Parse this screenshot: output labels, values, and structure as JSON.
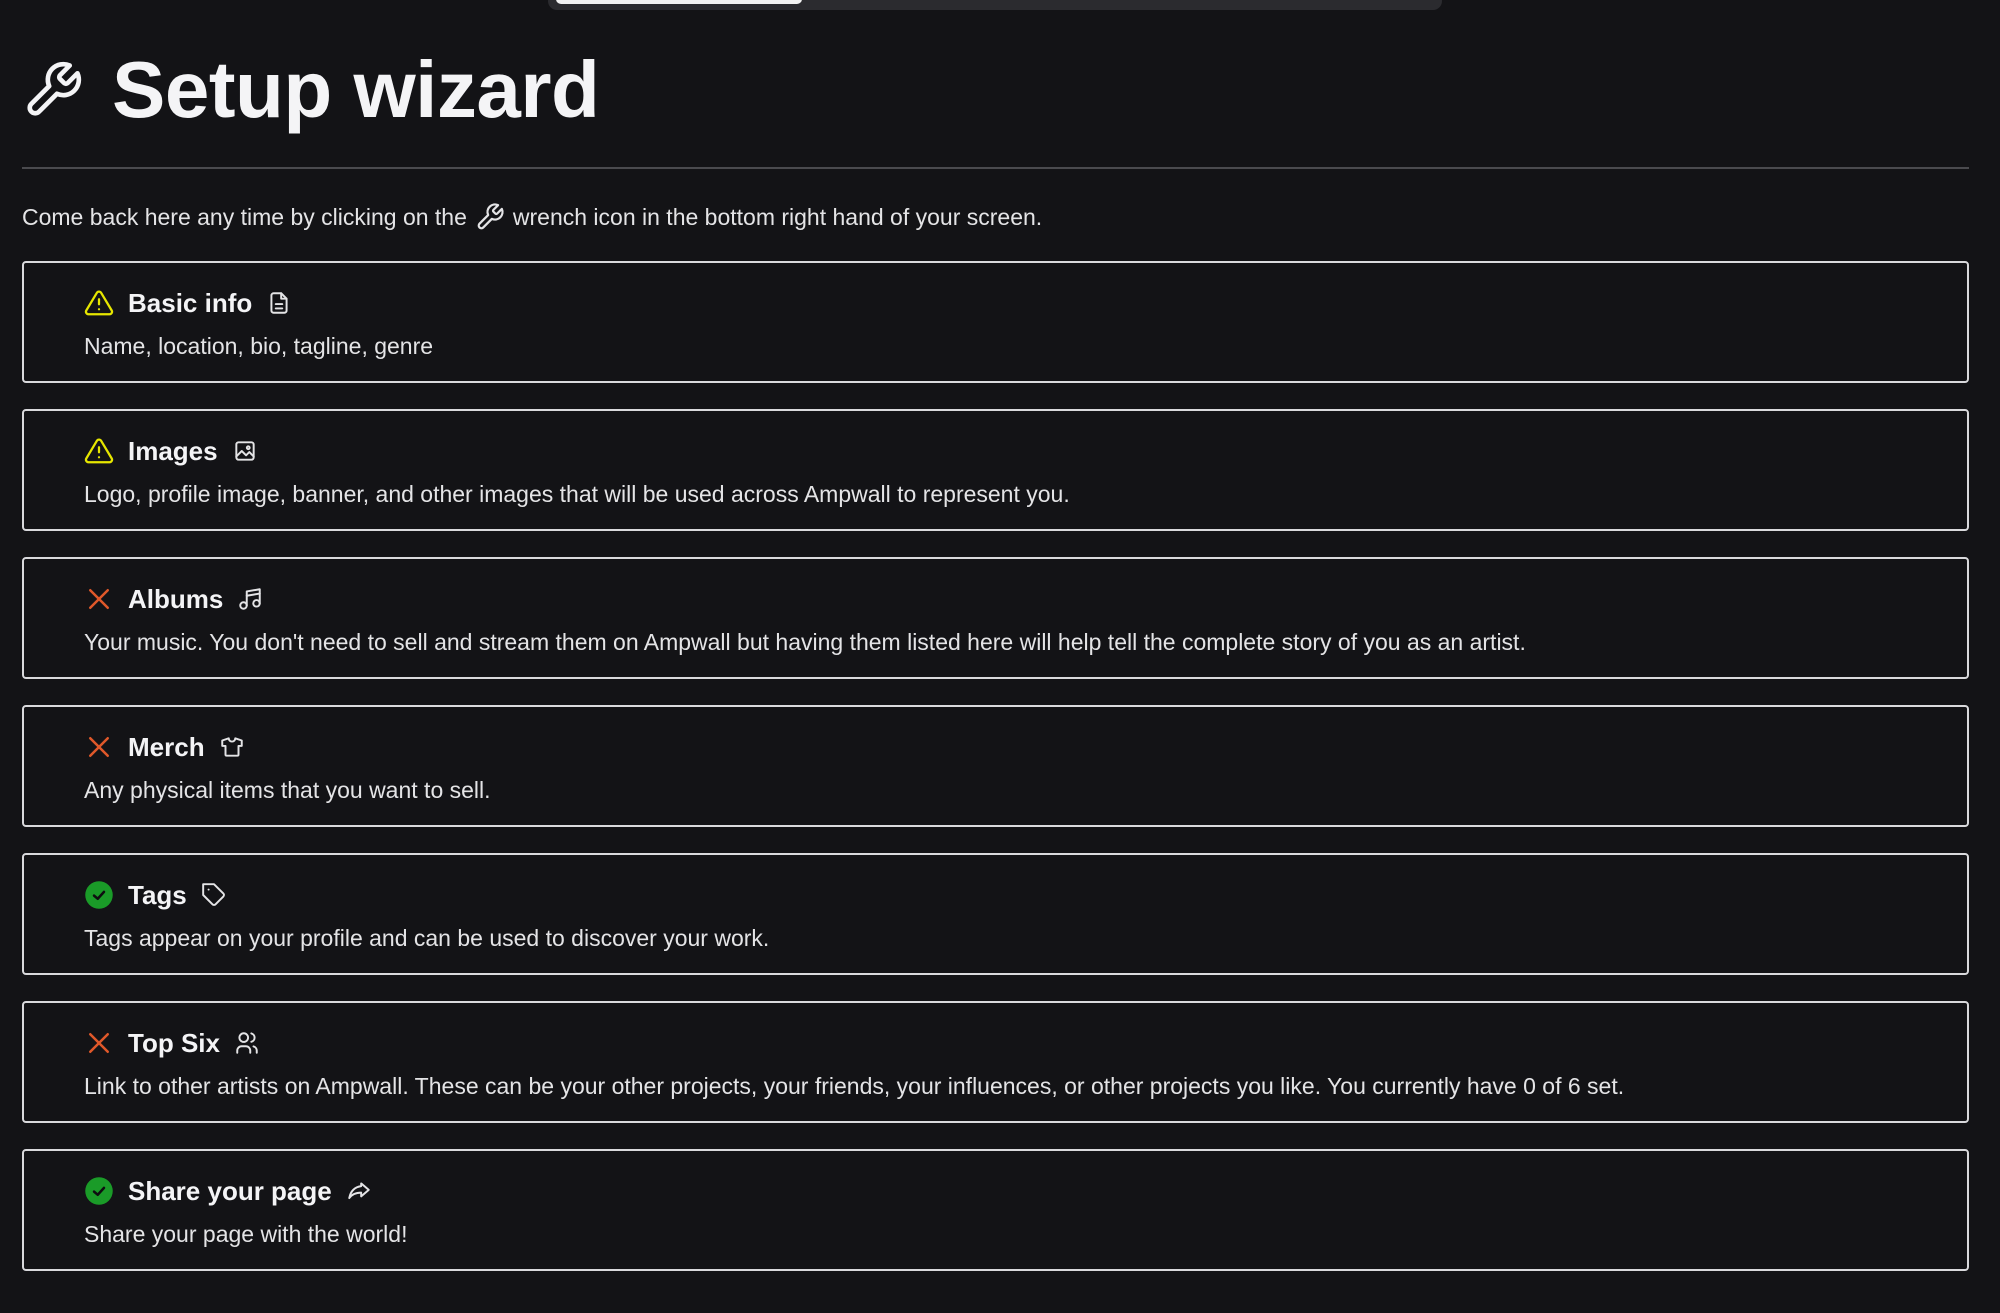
{
  "page": {
    "title": "Setup wizard",
    "title_icon": "wrench-icon",
    "intro_before": "Come back here any time by clicking on the",
    "intro_icon": "wrench-icon",
    "intro_after": "wrench icon in the bottom right hand of your screen."
  },
  "colors": {
    "background": "#131316",
    "warning": "#e6e600",
    "incomplete": "#e0582a",
    "complete": "#1a9b28",
    "text": "#ececee"
  },
  "steps": [
    {
      "title": "Basic info",
      "status": "warning",
      "icon": "document-icon",
      "description": "Name, location, bio, tagline, genre"
    },
    {
      "title": "Images",
      "status": "warning",
      "icon": "image-icon",
      "description": "Logo, profile image, banner, and other images that will be used across Ampwall to represent you."
    },
    {
      "title": "Albums",
      "status": "incomplete",
      "icon": "music-note-icon",
      "description": "Your music. You don't need to sell and stream them on Ampwall but having them listed here will help tell the complete story of you as an artist."
    },
    {
      "title": "Merch",
      "status": "incomplete",
      "icon": "tshirt-icon",
      "description": "Any physical items that you want to sell."
    },
    {
      "title": "Tags",
      "status": "complete",
      "icon": "tag-icon",
      "description": "Tags appear on your profile and can be used to discover your work."
    },
    {
      "title": "Top Six",
      "status": "incomplete",
      "icon": "users-icon",
      "description": "Link to other artists on Ampwall. These can be your other projects, your friends, your influences, or other projects you like. You currently have 0 of 6 set."
    },
    {
      "title": "Share your page",
      "status": "complete",
      "icon": "share-icon",
      "description": "Share your page with the world!"
    }
  ]
}
